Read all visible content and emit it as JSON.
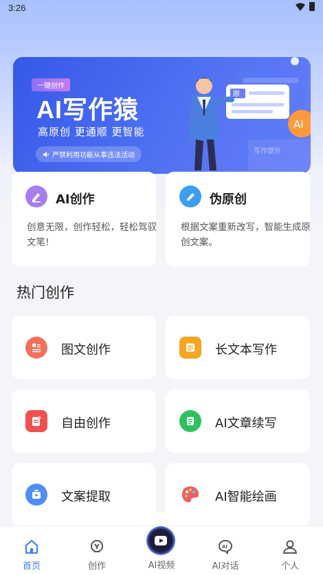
{
  "status_bar": {
    "time": "3:26"
  },
  "banner": {
    "tag": "一键创作",
    "title": "AI写作猿",
    "subtitle": "高原创  更通顺  更智能",
    "notice": "严禁利用功能从事违法活动",
    "art_badge_1": "原",
    "art_badge_2": "AI",
    "art_caption": "写作提升"
  },
  "cards": [
    {
      "title": "AI创作",
      "description": "创意无限，创作轻松，轻松驾驭文笔!",
      "icon": "pen-icon",
      "color": "#a67ef2"
    },
    {
      "title": "伪原创",
      "description": "根据文案重新改写，智能生成原创文案。",
      "icon": "edit-icon",
      "color": "#3d9df0"
    }
  ],
  "section_title": "热门创作",
  "features": [
    {
      "label": "图文创作",
      "icon": "image-text-icon",
      "color": "#f2715a"
    },
    {
      "label": "长文本写作",
      "icon": "long-text-icon",
      "color": "#f5a623"
    },
    {
      "label": "自由创作",
      "icon": "free-write-icon",
      "color": "#f05050"
    },
    {
      "label": "AI文章续写",
      "icon": "continue-write-icon",
      "color": "#2fc15f"
    },
    {
      "label": "文案提取",
      "icon": "extract-icon",
      "color": "#4f8df2"
    },
    {
      "label": "AI智能绘画",
      "icon": "palette-icon",
      "color": "#f06060"
    }
  ],
  "tabs": [
    {
      "label": "首页",
      "icon": "home-icon",
      "active": true
    },
    {
      "label": "创作",
      "icon": "create-icon",
      "active": false
    },
    {
      "label": "AI视频",
      "icon": "play-icon",
      "active": false
    },
    {
      "label": "AI对话",
      "icon": "chat-icon",
      "active": false
    },
    {
      "label": "个人",
      "icon": "profile-icon",
      "active": false
    }
  ],
  "colors": {
    "accent": "#3b7bf0",
    "banner": "#4063ee"
  }
}
